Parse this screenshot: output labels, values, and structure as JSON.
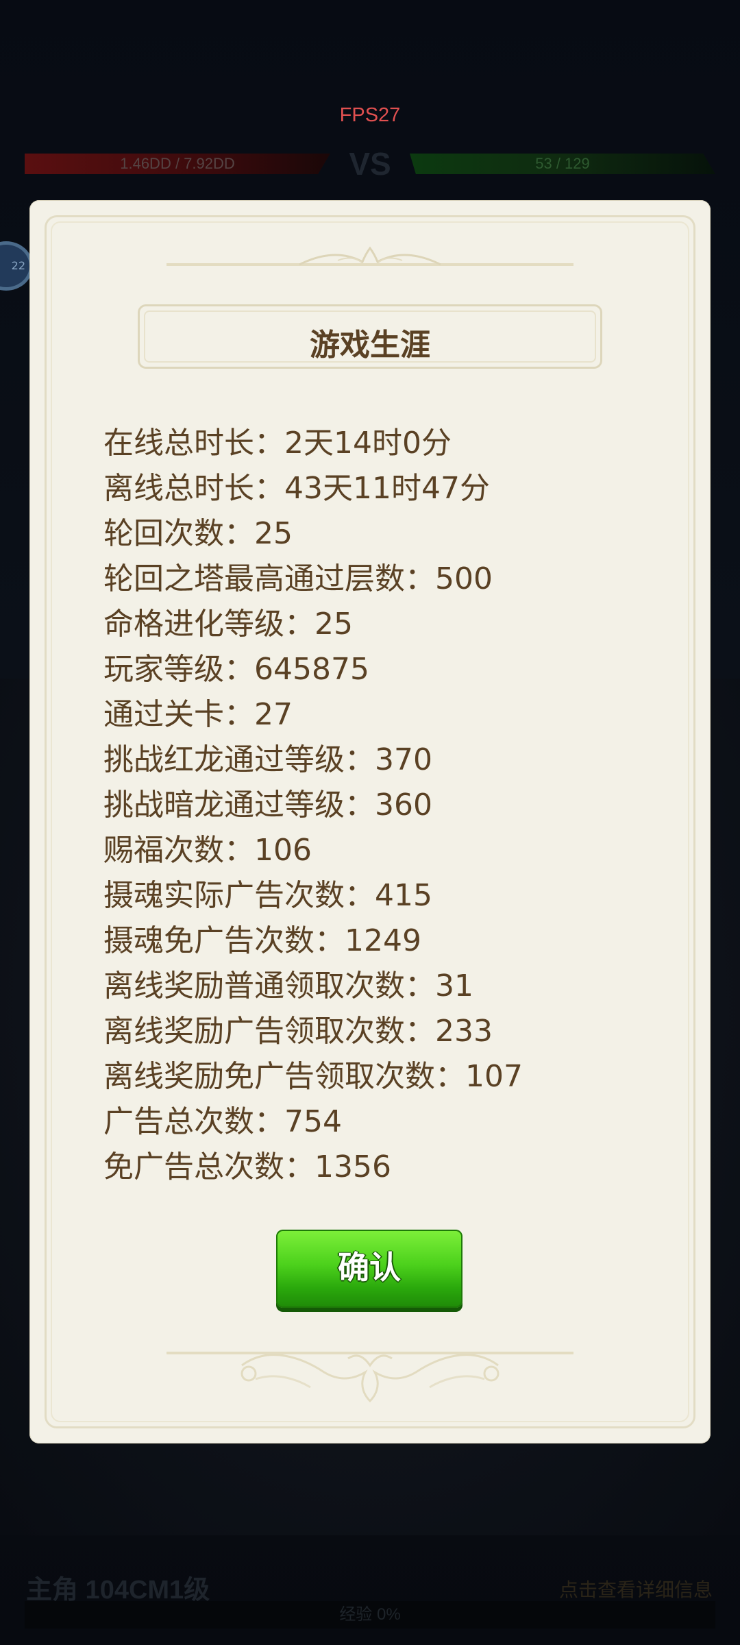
{
  "hud": {
    "fps": "FPS27",
    "left_hp": "1.46DD / 7.92DD",
    "vs": "VS",
    "right_hp": "53 / 129",
    "side_badge": "22"
  },
  "bottom": {
    "title": "主角 104CM1级",
    "right_text": "点击查看详细信息",
    "exp": "经验 0%"
  },
  "dialog": {
    "title": "游戏生涯",
    "stats": [
      "在线总时长：2天14时0分",
      "离线总时长：43天11时47分",
      "轮回次数：25",
      "轮回之塔最高通过层数：500",
      "命格进化等级：25",
      "玩家等级：645875",
      "通过关卡：27",
      "挑战红龙通过等级：370",
      "挑战暗龙通过等级：360",
      "赐福次数：106",
      "摄魂实际广告次数：415",
      "摄魂免广告次数：1249",
      "离线奖励普通领取次数：31",
      "离线奖励广告领取次数：233",
      "离线奖励免广告领取次数：107",
      "广告总次数：754",
      "免广告总次数：1356"
    ],
    "confirm_label": "确认"
  },
  "colors": {
    "dialog_bg": "#f3f1e7",
    "text": "#5a4124",
    "button_green": "#4cd11c",
    "fps_red": "#e05050"
  }
}
